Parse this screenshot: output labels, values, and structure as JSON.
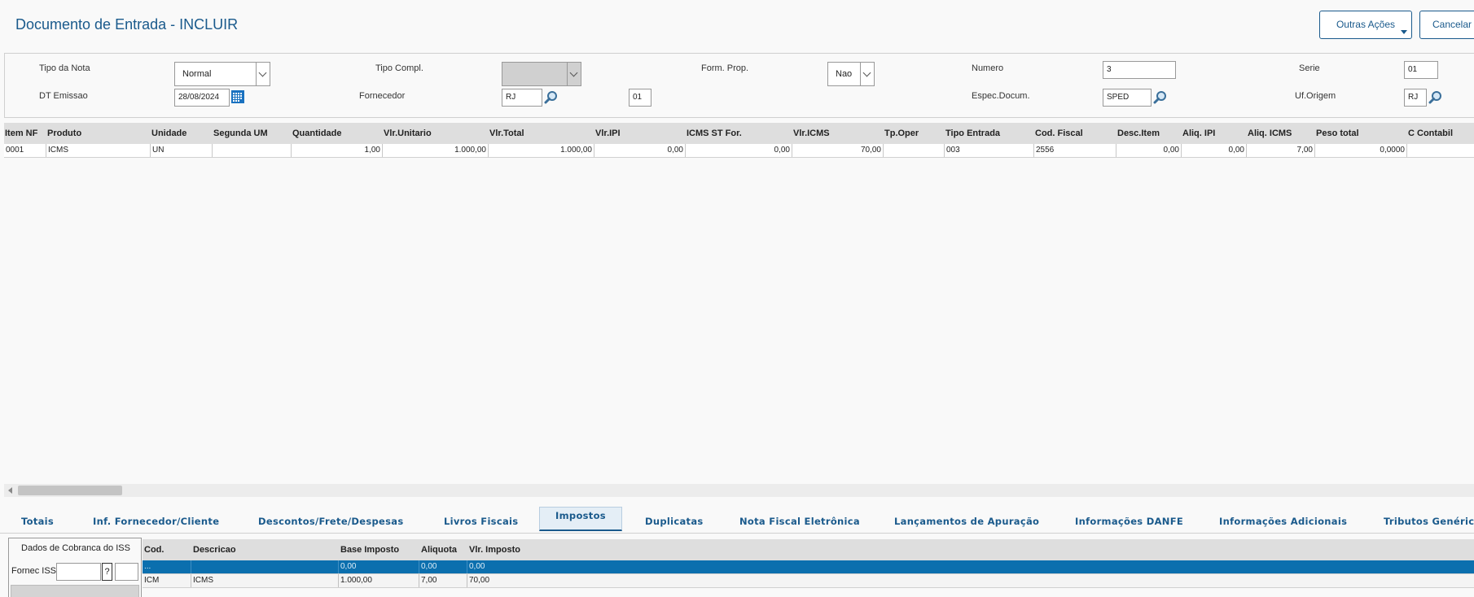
{
  "header": {
    "title": "Documento de Entrada - INCLUIR",
    "outras_acoes": "Outras Ações",
    "cancelar": "Cancelar"
  },
  "form": {
    "tipo_nota": {
      "label": "Tipo da Nota",
      "value": "Normal"
    },
    "tipo_compl": {
      "label": "Tipo Compl.",
      "value": ""
    },
    "form_prop": {
      "label": "Form. Prop.",
      "value": "Nao"
    },
    "numero": {
      "label": "Numero",
      "value": "3"
    },
    "serie": {
      "label": "Serie",
      "value": "01"
    },
    "dt_emissao": {
      "label": "DT Emissao",
      "value": "28/08/2024"
    },
    "fornecedor": {
      "label": "Fornecedor",
      "value": "RJ",
      "loja": "01"
    },
    "espec_docum": {
      "label": "Espec.Docum.",
      "value": "SPED"
    },
    "uf_origem": {
      "label": "Uf.Origem",
      "value": "RJ"
    }
  },
  "grid": {
    "columns": [
      "Item NF",
      "Produto",
      "Unidade",
      "Segunda UM",
      "Quantidade",
      "Vlr.Unitario",
      "Vlr.Total",
      "Vlr.IPI",
      "ICMS ST For.",
      "Vlr.ICMS",
      "Tp.Oper",
      "Tipo Entrada",
      "Cod. Fiscal",
      "Desc.Item",
      "Aliq. IPI",
      "Aliq. ICMS",
      "Peso total",
      "C Contabil"
    ],
    "rows": [
      [
        "0001",
        "ICMS",
        "UN",
        "",
        "1,00",
        "1.000,00",
        "1.000,00",
        "0,00",
        "0,00",
        "70,00",
        "",
        "003",
        "2556",
        "0,00",
        "0,00",
        "7,00",
        "0,0000",
        ""
      ]
    ]
  },
  "tabs": [
    "Totais",
    "Inf. Fornecedor/Cliente",
    "Descontos/Frete/Despesas",
    "Livros Fiscais",
    "Impostos",
    "Duplicatas",
    "Nota Fiscal Eletrônica",
    "Lançamentos de Apuração",
    "Informações DANFE",
    "Informações Adicionais",
    "Tributos Genéricos"
  ],
  "active_tab": "Impostos",
  "iss": {
    "title": "Dados de Cobranca do ISS",
    "fornec_label": "Fornec ISS",
    "help": "?"
  },
  "taxes": {
    "columns": [
      "Cod.",
      "Descricao",
      "Base Imposto",
      "Aliquota",
      "Vlr. Imposto"
    ],
    "rows": [
      [
        "...",
        "",
        "0,00",
        "0,00",
        "0,00"
      ],
      [
        "ICM",
        "ICMS",
        "1.000,00",
        "7,00",
        "70,00"
      ]
    ]
  },
  "colors": {
    "accent": "#1a5a8c",
    "selected_row": "#0b6fae"
  }
}
